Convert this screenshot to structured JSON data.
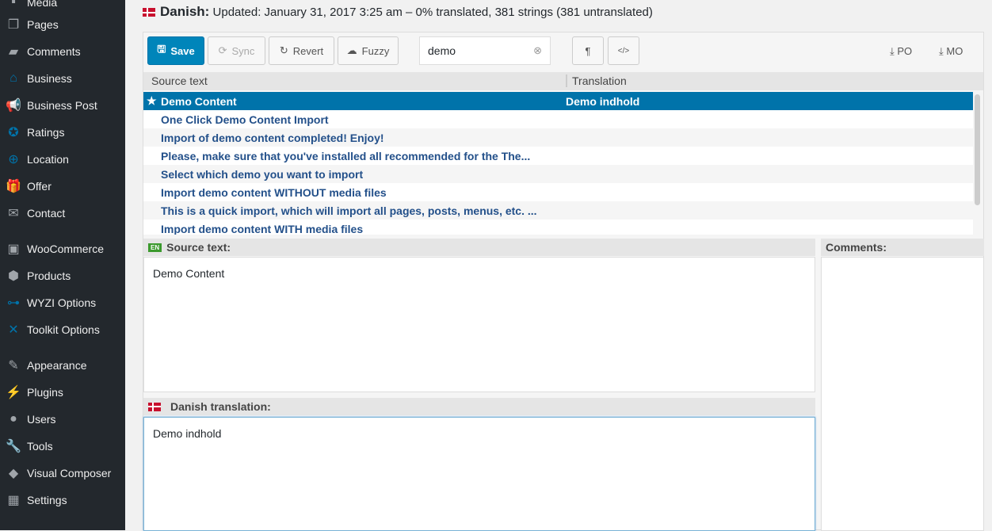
{
  "sidebar": {
    "items": [
      {
        "label": "Media",
        "icon": "media-icon"
      },
      {
        "label": "Pages",
        "icon": "pages-icon"
      },
      {
        "label": "Comments",
        "icon": "comment-icon"
      },
      {
        "label": "Business",
        "icon": "store-icon"
      },
      {
        "label": "Business Post",
        "icon": "megaphone-icon"
      },
      {
        "label": "Ratings",
        "icon": "star-icon"
      },
      {
        "label": "Location",
        "icon": "crosshair-icon"
      },
      {
        "label": "Offer",
        "icon": "gift-icon"
      },
      {
        "label": "Contact",
        "icon": "envelope-icon"
      },
      {
        "label": "WooCommerce",
        "icon": "woo-icon"
      },
      {
        "label": "Products",
        "icon": "box-icon"
      },
      {
        "label": "WYZI Options",
        "icon": "toggle-icon"
      },
      {
        "label": "Toolkit Options",
        "icon": "tools-icon"
      },
      {
        "label": "Appearance",
        "icon": "brush-icon"
      },
      {
        "label": "Plugins",
        "icon": "plugin-icon"
      },
      {
        "label": "Users",
        "icon": "user-icon"
      },
      {
        "label": "Tools",
        "icon": "wrench-icon"
      },
      {
        "label": "Visual Composer",
        "icon": "vc-icon"
      },
      {
        "label": "Settings",
        "icon": "settings-icon"
      }
    ]
  },
  "header": {
    "language": "Danish:",
    "status": "Updated: January 31, 2017 3:25 am – 0% translated, 381 strings (381 untranslated)"
  },
  "toolbar": {
    "save": "Save",
    "sync": "Sync",
    "revert": "Revert",
    "fuzzy": "Fuzzy",
    "search_value": "demo",
    "pilcrow": "¶",
    "code": "</>",
    "po": "PO",
    "mo": "MO"
  },
  "list": {
    "headers": {
      "source": "Source text",
      "translation": "Translation"
    },
    "rows": [
      {
        "source": "Demo Content",
        "translation": "Demo indhold"
      },
      {
        "source": "One Click Demo Content Import",
        "translation": ""
      },
      {
        "source": "Import of demo content completed! Enjoy!",
        "translation": ""
      },
      {
        "source": "Please, make sure that you've installed all recommended for the The...",
        "translation": ""
      },
      {
        "source": "Select which demo you want to import",
        "translation": ""
      },
      {
        "source": "Import demo content WITHOUT media files",
        "translation": ""
      },
      {
        "source": "This is a quick import, which will import all pages, posts, menus, etc. ...",
        "translation": ""
      },
      {
        "source": "Import demo content WITH media files",
        "translation": ""
      }
    ]
  },
  "source_pane": {
    "badge": "EN",
    "label": "Source text:",
    "text": "Demo Content"
  },
  "comments_pane": {
    "label": "Comments:"
  },
  "translation_pane": {
    "label": "Danish translation:",
    "text": "Demo indhold"
  },
  "colors": {
    "accent": "#0073aa",
    "sidebar": "#23282d"
  }
}
